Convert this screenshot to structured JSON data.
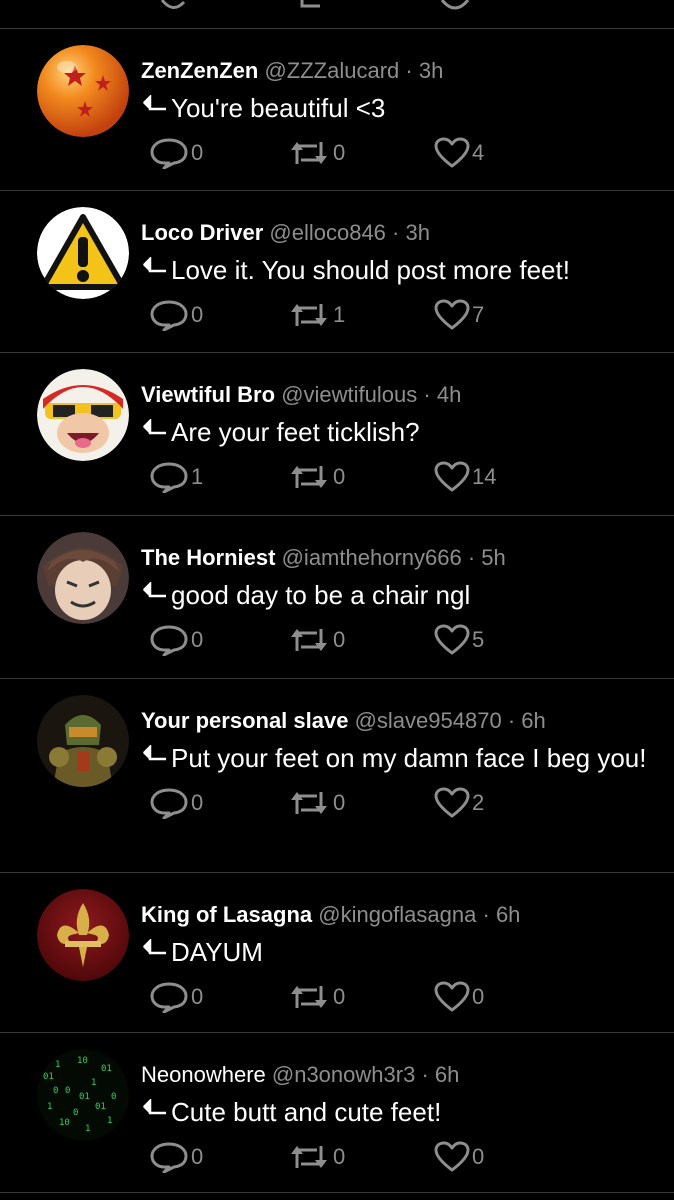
{
  "replies": [
    {
      "name": "ZenZenZen",
      "handle": "@ZZZalucard",
      "time": "3h",
      "text": "You're beautiful <3",
      "comments": "0",
      "retweets": "0",
      "likes": "4",
      "avatar": "dragon-ball"
    },
    {
      "name": "Loco Driver",
      "handle": "@elloco846",
      "time": "3h",
      "text": "Love it. You should post more feet!",
      "comments": "0",
      "retweets": "1",
      "likes": "7",
      "avatar": "warning-sign"
    },
    {
      "name": "Viewtiful Bro",
      "handle": "@viewtifulous",
      "time": "4h",
      "text": "Are your feet ticklish?",
      "comments": "1",
      "retweets": "0",
      "likes": "14",
      "avatar": "cartoon-hero"
    },
    {
      "name": "The Horniest",
      "handle": "@iamthehorny666",
      "time": "5h",
      "text": "good day to be a chair ngl",
      "comments": "0",
      "retweets": "0",
      "likes": "5",
      "avatar": "anime-face"
    },
    {
      "name": "Your personal slave",
      "handle": "@slave954870",
      "time": "6h",
      "text": "Put your feet on my damn face I beg you!",
      "comments": "0",
      "retweets": "0",
      "likes": "2",
      "avatar": "armored-soldier"
    },
    {
      "name": "King of Lasagna",
      "handle": "@kingoflasagna",
      "time": "6h",
      "text": "DAYUM",
      "comments": "0",
      "retweets": "0",
      "likes": "0",
      "avatar": "fleur-de-lis"
    },
    {
      "name": "Neonowhere",
      "handle": "@n3onowh3r3",
      "time": "6h",
      "text": "Cute butt and cute feet!",
      "comments": "0",
      "retweets": "0",
      "likes": "0",
      "avatar": "matrix-code"
    }
  ],
  "meta_separator": "·",
  "colors": {
    "background": "#000000",
    "secondary_text": "#8e8e8e",
    "divider": "#3a3a3a"
  }
}
